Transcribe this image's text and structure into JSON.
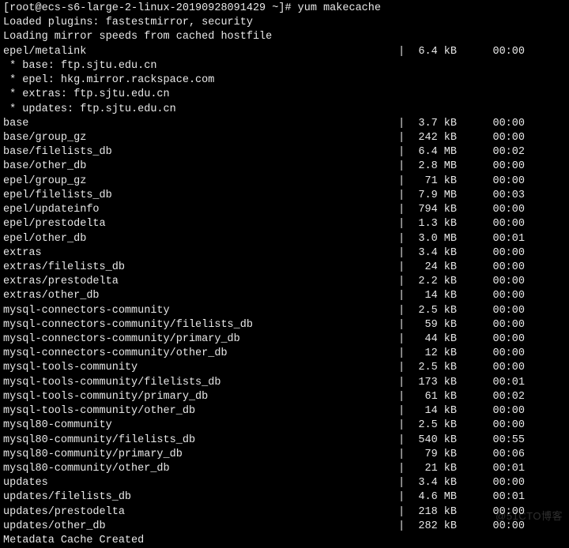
{
  "prompt": {
    "prefix": "[root@ecs-s6-large-2-linux-20190928091429 ~]# ",
    "command": "yum makecache"
  },
  "header_lines": [
    "Loaded plugins: fastestmirror, security",
    "Loading mirror speeds from cached hostfile"
  ],
  "first_row": {
    "name": "epel/metalink",
    "size": "6.4 kB",
    "time": "00:00"
  },
  "mirror_lines": [
    " * base: ftp.sjtu.edu.cn",
    " * epel: hkg.mirror.rackspace.com",
    " * extras: ftp.sjtu.edu.cn",
    " * updates: ftp.sjtu.edu.cn"
  ],
  "rows": [
    {
      "name": "base",
      "size": "3.7 kB",
      "time": "00:00"
    },
    {
      "name": "base/group_gz",
      "size": "242 kB",
      "time": "00:00"
    },
    {
      "name": "base/filelists_db",
      "size": "6.4 MB",
      "time": "00:02"
    },
    {
      "name": "base/other_db",
      "size": "2.8 MB",
      "time": "00:00"
    },
    {
      "name": "epel/group_gz",
      "size": " 71 kB",
      "time": "00:00"
    },
    {
      "name": "epel/filelists_db",
      "size": "7.9 MB",
      "time": "00:03"
    },
    {
      "name": "epel/updateinfo",
      "size": "794 kB",
      "time": "00:00"
    },
    {
      "name": "epel/prestodelta",
      "size": "1.3 kB",
      "time": "00:00"
    },
    {
      "name": "epel/other_db",
      "size": "3.0 MB",
      "time": "00:01"
    },
    {
      "name": "extras",
      "size": "3.4 kB",
      "time": "00:00"
    },
    {
      "name": "extras/filelists_db",
      "size": " 24 kB",
      "time": "00:00"
    },
    {
      "name": "extras/prestodelta",
      "size": "2.2 kB",
      "time": "00:00"
    },
    {
      "name": "extras/other_db",
      "size": " 14 kB",
      "time": "00:00"
    },
    {
      "name": "mysql-connectors-community",
      "size": "2.5 kB",
      "time": "00:00"
    },
    {
      "name": "mysql-connectors-community/filelists_db",
      "size": " 59 kB",
      "time": "00:00"
    },
    {
      "name": "mysql-connectors-community/primary_db",
      "size": " 44 kB",
      "time": "00:00"
    },
    {
      "name": "mysql-connectors-community/other_db",
      "size": " 12 kB",
      "time": "00:00"
    },
    {
      "name": "mysql-tools-community",
      "size": "2.5 kB",
      "time": "00:00"
    },
    {
      "name": "mysql-tools-community/filelists_db",
      "size": "173 kB",
      "time": "00:01"
    },
    {
      "name": "mysql-tools-community/primary_db",
      "size": " 61 kB",
      "time": "00:02"
    },
    {
      "name": "mysql-tools-community/other_db",
      "size": " 14 kB",
      "time": "00:00"
    },
    {
      "name": "mysql80-community",
      "size": "2.5 kB",
      "time": "00:00"
    },
    {
      "name": "mysql80-community/filelists_db",
      "size": "540 kB",
      "time": "00:55"
    },
    {
      "name": "mysql80-community/primary_db",
      "size": " 79 kB",
      "time": "00:06"
    },
    {
      "name": "mysql80-community/other_db",
      "size": " 21 kB",
      "time": "00:01"
    },
    {
      "name": "updates",
      "size": "3.4 kB",
      "time": "00:00"
    },
    {
      "name": "updates/filelists_db",
      "size": "4.6 MB",
      "time": "00:01"
    },
    {
      "name": "updates/prestodelta",
      "size": "218 kB",
      "time": "00:00"
    },
    {
      "name": "updates/other_db",
      "size": "282 kB",
      "time": "00:00"
    }
  ],
  "footer": "Metadata Cache Created",
  "watermark": "@51CTO博客"
}
